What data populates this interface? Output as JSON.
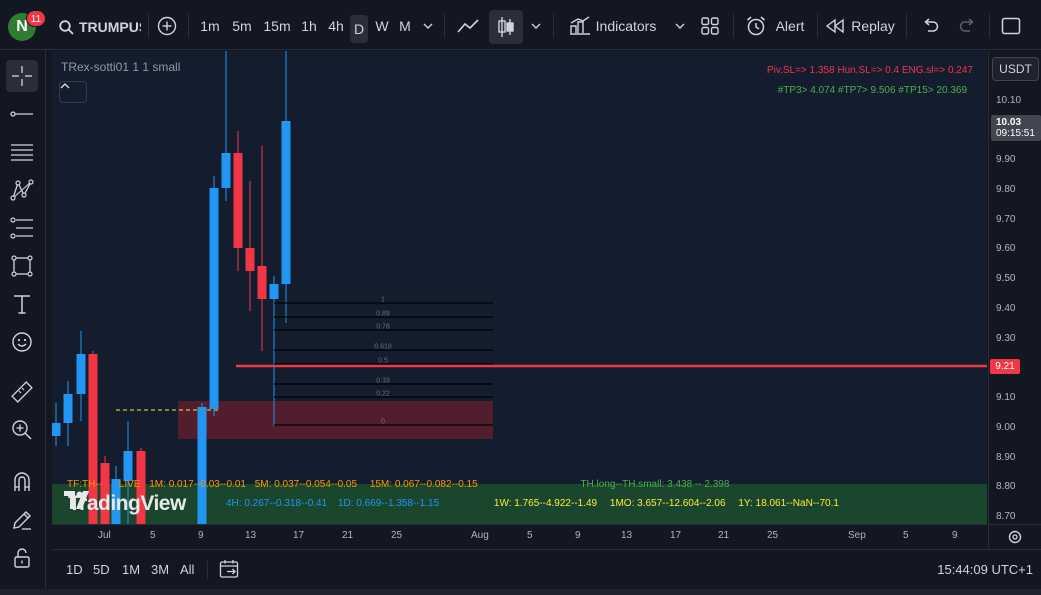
{
  "app": {
    "avatar_letter": "N",
    "notification_count": "11",
    "symbol": "TRUMPUSDT"
  },
  "toolbar": {
    "intervals": [
      "1m",
      "5m",
      "15m",
      "1h",
      "4h",
      "D",
      "W",
      "M"
    ],
    "active_interval": "D",
    "indicators_label": "Indicators",
    "alert_label": "Alert",
    "replay_label": "Replay"
  },
  "chart": {
    "legend_title": "TRex-sotti01 1 1 small",
    "info_red": "Piv.SL=> 1.358  Hun.SL=> 0.4  ENG.sl=> 0.247",
    "info_green": "#TP3> 4.074  #TP7> 9.506  #TP15> 20.369",
    "fib_labels": [
      "1",
      "0.89",
      "0.78",
      "0.618",
      "0.5",
      "0.33",
      "0.22",
      "0"
    ],
    "table": {
      "row1": [
        {
          "text": "TF:TH--",
          "color": "#ff9800"
        },
        {
          "text": "LIVE",
          "color": "#ff9800"
        },
        {
          "text": "1M: 0.017--0.03--0.01",
          "color": "#ff9800"
        },
        {
          "text": "5M: 0.037--0.054--0.05",
          "color": "#ff9800"
        },
        {
          "text": "15M: 0.067--0.082--0.15",
          "color": "#ff9800"
        },
        {
          "text": "TH.long--TH.small: 3.438 -- 2.398",
          "color": "#4caf50"
        }
      ],
      "row2": [
        {
          "text": "4H: 0.267--0.318--0.41",
          "color": "#2196f3"
        },
        {
          "text": "1D: 0.669--1.358--1.15",
          "color": "#2196f3"
        },
        {
          "text": "1W: 1.765--4.922--1.49",
          "color": "#ffeb3b"
        },
        {
          "text": "1MO: 3.657--12.604--2.06",
          "color": "#ffeb3b"
        },
        {
          "text": "1Y: 18.061--NaN--70.1",
          "color": "#ffeb3b"
        }
      ]
    },
    "watermark": "TradingView"
  },
  "price_axis": {
    "currency": "USDT",
    "labels": [
      "10.10",
      "9.90",
      "9.80",
      "9.70",
      "9.60",
      "9.50",
      "9.40",
      "9.30",
      "9.10",
      "9.00",
      "8.90",
      "8.80",
      "8.70"
    ],
    "current_price": "10.03",
    "countdown": "09:15:51",
    "red_line_price": "9.21"
  },
  "time_axis": {
    "labels": [
      "Jul",
      "5",
      "9",
      "13",
      "17",
      "21",
      "25",
      "Aug",
      "5",
      "9",
      "13",
      "17",
      "21",
      "25",
      "Sep",
      "5",
      "9"
    ]
  },
  "bottom": {
    "ranges": [
      "1D",
      "5D",
      "1M",
      "3M",
      "All"
    ],
    "clock": "15:44:09 UTC+1"
  },
  "colors": {
    "bull": "#2196f3",
    "bear": "#f23645",
    "background": "#131722",
    "chart_bg": "#131d2e",
    "zone_red": "#5a1f2e",
    "zone_green": "#1b4d2b"
  }
}
